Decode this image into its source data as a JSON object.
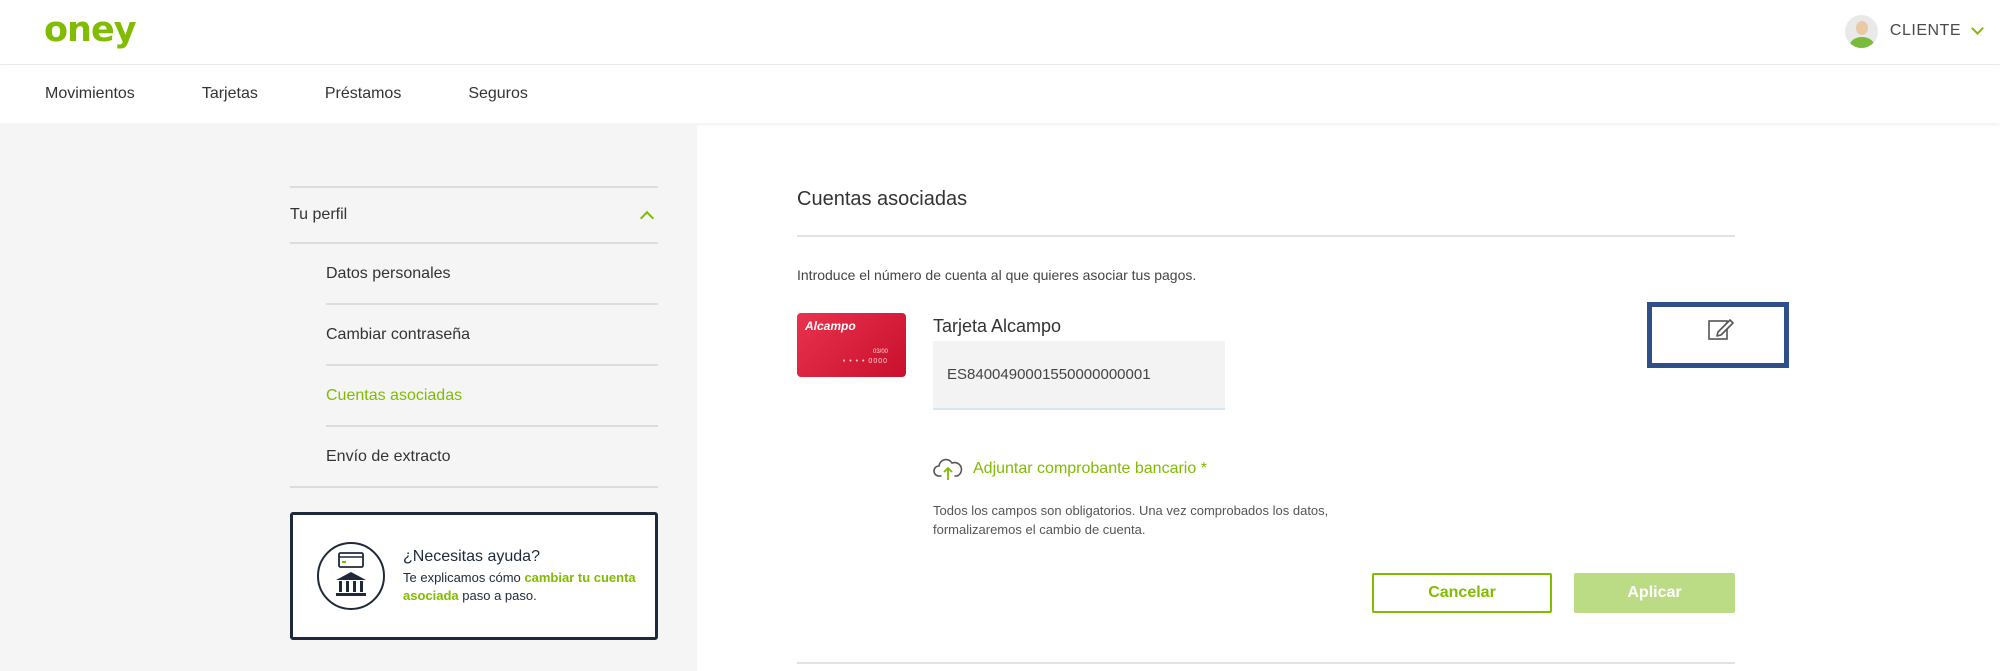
{
  "header": {
    "logo": "oney",
    "user_label": "CLIENTE"
  },
  "nav": {
    "items": [
      "Movimientos",
      "Tarjetas",
      "Préstamos",
      "Seguros"
    ]
  },
  "sidebar": {
    "section_title": "Tu perfil",
    "items": [
      {
        "label": "Datos personales",
        "active": false
      },
      {
        "label": "Cambiar contraseña",
        "active": false
      },
      {
        "label": "Cuentas asociadas",
        "active": true
      },
      {
        "label": "Envío de extracto",
        "active": false
      }
    ]
  },
  "help": {
    "title": "¿Necesitas ayuda?",
    "text_before": "Te explicamos cómo ",
    "highlight": "cambiar tu cuenta asociada",
    "text_after": " paso a paso."
  },
  "main": {
    "title": "Cuentas asociadas",
    "intro": "Introduce el número de cuenta al que quieres asociar tus pagos.",
    "card": {
      "brand": "Alcampo",
      "date": "03/00",
      "number": "• • • •  0000",
      "name": "Tarjeta Alcampo"
    },
    "iban_value": "ES8400490001550000000001",
    "attach_label": "Adjuntar comprobante bancario *",
    "note": "Todos los campos son obligatorios. Una vez comprobados los datos, formalizaremos el cambio de cuenta.",
    "cancel_label": "Cancelar",
    "apply_label": "Aplicar"
  },
  "colors": {
    "brand_green": "#81bc00",
    "apply_disabled": "#bcdb85",
    "card_red": "#c8102e",
    "highlight_box": "#2e4f8a"
  }
}
